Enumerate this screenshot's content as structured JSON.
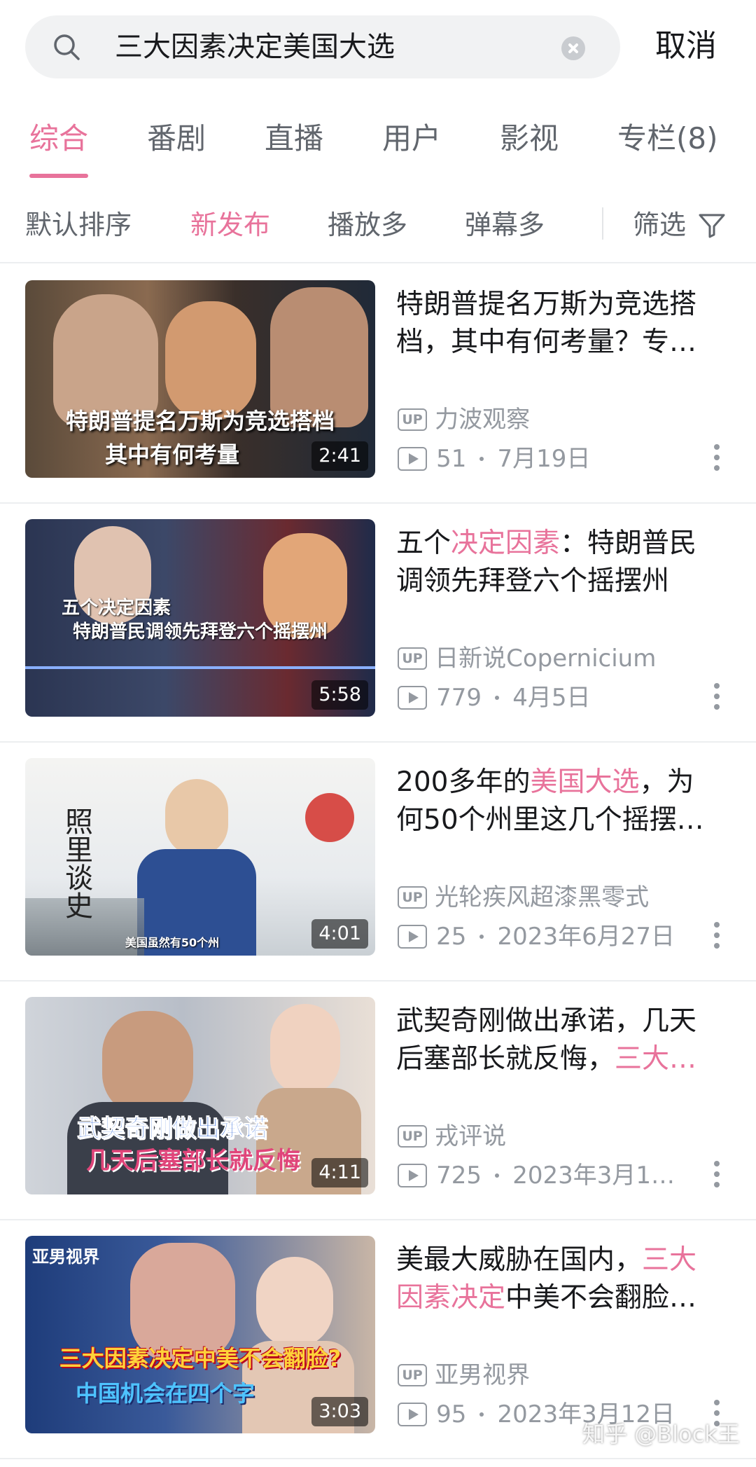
{
  "search": {
    "query": "三大因素决定美国大选",
    "cancel_label": "取消"
  },
  "tabs": [
    {
      "label": "综合",
      "active": true
    },
    {
      "label": "番剧",
      "active": false
    },
    {
      "label": "直播",
      "active": false
    },
    {
      "label": "用户",
      "active": false
    },
    {
      "label": "影视",
      "active": false
    },
    {
      "label": "专栏(8)",
      "active": false
    }
  ],
  "sort": {
    "options": [
      "默认排序",
      "新发布",
      "播放多",
      "弹幕多"
    ],
    "active": "新发布",
    "filter_label": "筛选"
  },
  "colors": {
    "accent": "#e8739b",
    "muted": "#9499a0",
    "text": "#18191c"
  },
  "up_badge": "UP",
  "results": [
    {
      "title_line1": "特朗普提名万斯为竞选搭",
      "title_line2": "档，其中有何考量？专…",
      "uploader": "力波观察",
      "plays": "51",
      "date": "7月19日",
      "duration": "2:41",
      "thumb_caption1": "特朗普提名万斯为竞选搭档",
      "thumb_caption2": "其中有何考量"
    },
    {
      "title_pre": "五个",
      "title_hl": "决定因素",
      "title_post": "：特朗普民",
      "title_line2": "调领先拜登六个摇摆州",
      "uploader": "日新说Copernicium",
      "plays": "779",
      "date": "4月5日",
      "duration": "5:58",
      "thumb_caption1": "五个决定因素",
      "thumb_caption2": "特朗普民调领先拜登六个摇摆州"
    },
    {
      "title_pre": "200多年的",
      "title_hl": "美国大选",
      "title_post": "，为",
      "title_line2": "何50个州里这几个摇摆…",
      "uploader": "光轮疾风超漆黑零式",
      "plays": "25",
      "date": "2023年6月27日",
      "duration": "4:01",
      "thumb_caption1": "照里谈史",
      "thumb_caption2": "美国虽然有50个州"
    },
    {
      "title_line1": "武契奇刚做出承诺，几天",
      "title_line2_pre": "后塞部长就反悔，",
      "title_line2_hl": "三大…",
      "uploader": "戎评说",
      "plays": "725",
      "date": "2023年3月1…",
      "duration": "4:11",
      "thumb_caption1": "武契奇刚做出承诺",
      "thumb_caption2": "几天后塞部长就反悔"
    },
    {
      "title_line1_pre": "美最大威胁在国内，",
      "title_line1_hl": "三大",
      "title_line2_hl": "因素决定",
      "title_line2_post": "中美不会翻脸…",
      "uploader": "亚男视界",
      "plays": "95",
      "date": "2023年3月12日",
      "duration": "3:03",
      "thumb_brand": "亚男视界",
      "thumb_caption1": "三大因素决定中美不会翻脸?",
      "thumb_caption2": "中国机会在四个字"
    }
  ],
  "watermark": "知乎 @Block王"
}
